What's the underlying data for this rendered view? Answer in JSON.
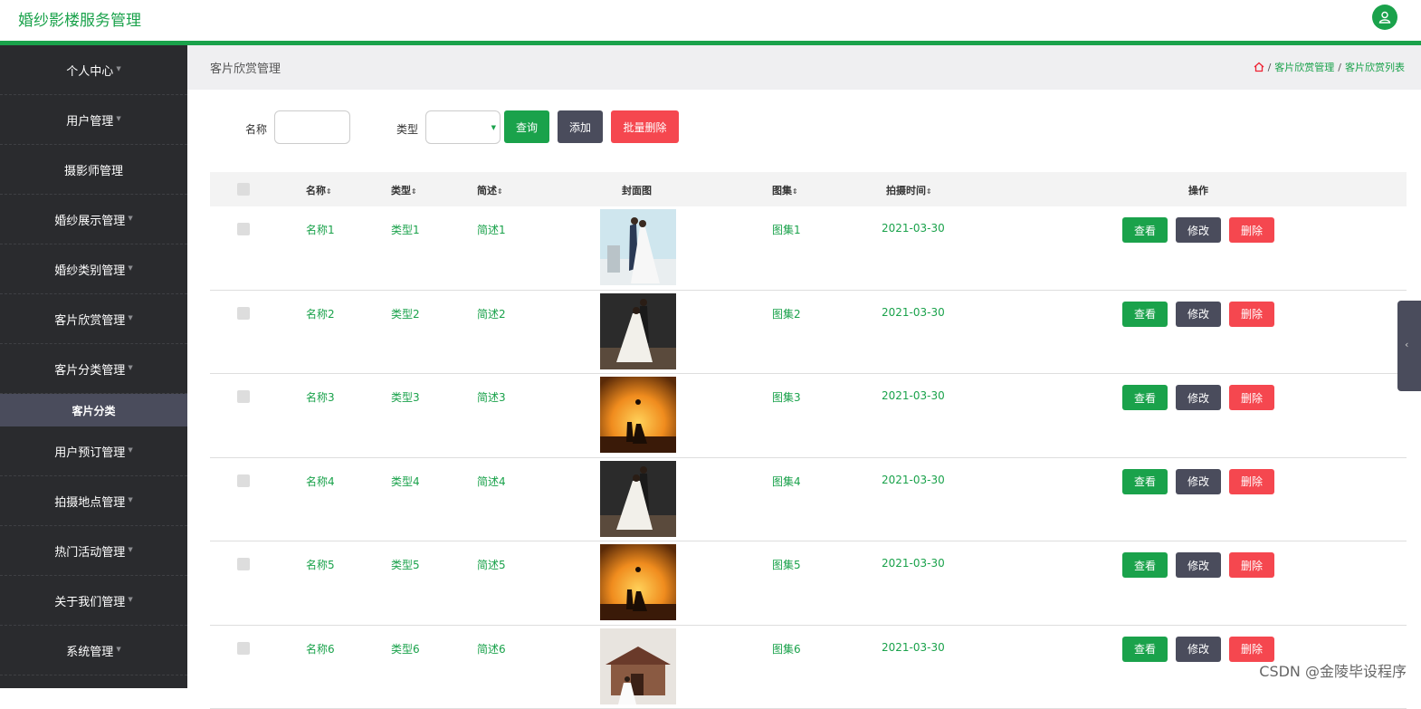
{
  "app": {
    "title": "婚纱影楼服务管理"
  },
  "sidebar": {
    "items": [
      {
        "label": "个人中心",
        "caret": true
      },
      {
        "label": "用户管理",
        "caret": true
      },
      {
        "label": "摄影师管理",
        "caret": false
      },
      {
        "label": "婚纱展示管理",
        "caret": true
      },
      {
        "label": "婚纱类别管理",
        "caret": true
      },
      {
        "label": "客片欣赏管理",
        "caret": true
      },
      {
        "label": "客片分类管理",
        "caret": true
      }
    ],
    "sub_item": "客片分类",
    "items_after": [
      {
        "label": "用户预订管理",
        "caret": true
      },
      {
        "label": "拍摄地点管理",
        "caret": true
      },
      {
        "label": "热门活动管理",
        "caret": true
      },
      {
        "label": "关于我们管理",
        "caret": true
      },
      {
        "label": "系统管理",
        "caret": true
      }
    ]
  },
  "page": {
    "heading": "客片欣赏管理",
    "breadcrumb": [
      "客片欣赏管理",
      "客片欣赏列表"
    ]
  },
  "search": {
    "name_label": "名称",
    "name_value": "",
    "type_label": "类型",
    "type_value": "",
    "query_button": "查询",
    "add_button": "添加",
    "batch_delete_button": "批量删除"
  },
  "table": {
    "headers": {
      "name": "名称",
      "type": "类型",
      "desc": "简述",
      "cover": "封面图",
      "gallery": "图集",
      "time": "拍摄时间",
      "actions": "操作"
    },
    "rows": [
      {
        "name": "名称1",
        "type": "类型1",
        "desc": "简述1",
        "gallery": "图集1",
        "time": "2021-03-30",
        "cover": "light"
      },
      {
        "name": "名称2",
        "type": "类型2",
        "desc": "简述2",
        "gallery": "图集2",
        "time": "2021-03-30",
        "cover": "dark"
      },
      {
        "name": "名称3",
        "type": "类型3",
        "desc": "简述3",
        "gallery": "图集3",
        "time": "2021-03-30",
        "cover": "sunset"
      },
      {
        "name": "名称4",
        "type": "类型4",
        "desc": "简述4",
        "gallery": "图集4",
        "time": "2021-03-30",
        "cover": "dark"
      },
      {
        "name": "名称5",
        "type": "类型5",
        "desc": "简述5",
        "gallery": "图集5",
        "time": "2021-03-30",
        "cover": "sunset"
      },
      {
        "name": "名称6",
        "type": "类型6",
        "desc": "简述6",
        "gallery": "图集6",
        "time": "2021-03-30",
        "cover": "castle"
      }
    ],
    "action_labels": {
      "view": "查看",
      "edit": "修改",
      "delete": "删除"
    }
  },
  "watermark": "CSDN @金陵毕设程序",
  "colors": {
    "accent": "#1aa24b",
    "sidebar": "#2a2b2e",
    "danger": "#f5474f",
    "slate": "#4a4c5c"
  }
}
